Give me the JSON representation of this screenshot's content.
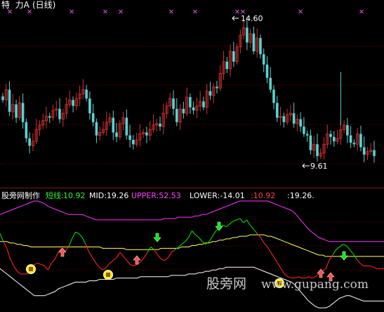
{
  "header": {
    "stock_name": "特  力A",
    "period": "(日线)",
    "peak_label": "14.60",
    "low_label": "9.61"
  },
  "indicator_bar": {
    "source": "股旁网制作",
    "short_label": "短线:",
    "short_value": "10.92",
    "mid_text": "MID:19.26",
    "upper_text": "UPPER:52.53",
    "lower_text": "LOWER:-14.01",
    "extra_value": ":10.92",
    "extra_text": ":19.26."
  },
  "watermark": {
    "cn": "股旁网",
    "url": "www.gupang.com"
  },
  "colors": {
    "up_candle": "#d03030",
    "down_candle": "#5ad2d2",
    "mid_line": "#ffff66",
    "upper_line": "#ff33ff",
    "lower_line": "#ffffff",
    "short_line_green": "#00dd00",
    "short_line_red": "#ff2222",
    "grid": "#8b0000",
    "buy_marker": "#ffee00",
    "up_arrow": "#ff5050",
    "down_arrow": "#00ee00",
    "x_marks": "#cc44cc"
  },
  "chart_data": [
    {
      "type": "candlestick",
      "title": "",
      "ylim": [
        9.2,
        15.2
      ],
      "price_labels": [
        14.6,
        9.61
      ],
      "closes": [
        12.05,
        12.4,
        11.65,
        11.9,
        11.45,
        11.95,
        11.3,
        10.75,
        10.5,
        10.65,
        11.05,
        11.2,
        11.35,
        11.5,
        11.45,
        11.7,
        11.75,
        11.4,
        11.6,
        11.9,
        12.05,
        11.85,
        12.1,
        12.25,
        12.4,
        12.1,
        11.6,
        11.3,
        10.85,
        10.95,
        11.05,
        11.3,
        11.45,
        10.95,
        10.8,
        11.25,
        11.45,
        10.85,
        10.7,
        10.55,
        10.7,
        10.9,
        10.95,
        10.85,
        11.05,
        11.2,
        11.25,
        11.15,
        11.6,
        11.85,
        12.1,
        11.75,
        11.3,
        11.75,
        11.6,
        12.15,
        11.8,
        11.7,
        11.85,
        12.0,
        11.8,
        12.35,
        12.2,
        12.5,
        12.45,
        12.95,
        13.35,
        13.1,
        13.7,
        13.35,
        13.85,
        14.25,
        14.5,
        14.0,
        14.3,
        13.7,
        14.15,
        13.6,
        13.25,
        12.8,
        12.4,
        11.95,
        11.45,
        11.5,
        11.3,
        11.55,
        11.6,
        11.25,
        11.4,
        11.15,
        10.9,
        10.85,
        10.35,
        10.55,
        10.15,
        10.25,
        10.55,
        10.9,
        10.8,
        10.65,
        10.75,
        11.05,
        11.2,
        10.85,
        10.6,
        10.55,
        10.9,
        10.45,
        10.2,
        10.3,
        10.35,
        10.15
      ]
    },
    {
      "type": "line",
      "title": "",
      "ylim": [
        -20,
        60
      ],
      "series": [
        {
          "name": "短线",
          "values": [
            36,
            30,
            25,
            17,
            12,
            8,
            6,
            6,
            6,
            9,
            13,
            14,
            13,
            12,
            9,
            14,
            17,
            22,
            25,
            23,
            26,
            32,
            37,
            36,
            33,
            28,
            22,
            18,
            14,
            11,
            9,
            11,
            14,
            16,
            18,
            22,
            19,
            16,
            13,
            12,
            13,
            15,
            18,
            22,
            26,
            24,
            20,
            17,
            16,
            18,
            22,
            24,
            26,
            28,
            30,
            33,
            38,
            35,
            33,
            30,
            28,
            30,
            34,
            38,
            40,
            42,
            41,
            43,
            45,
            46,
            47,
            44,
            46,
            42,
            39,
            36,
            33,
            29,
            26,
            22,
            18,
            14,
            10,
            6,
            4,
            3,
            3,
            4,
            3,
            3,
            4,
            3,
            4,
            6,
            8,
            10,
            16,
            20,
            24,
            26,
            28,
            27,
            24,
            21,
            17,
            14,
            12,
            12,
            12,
            11,
            10,
            10,
            10
          ]
        },
        {
          "name": "MID",
          "values": [
            30,
            30,
            30,
            29,
            29,
            28,
            28,
            27,
            27,
            26,
            26,
            26,
            26,
            26,
            26,
            26,
            26,
            26,
            26,
            26,
            26,
            26,
            26,
            26,
            26,
            26,
            26,
            26,
            26,
            26,
            25,
            25,
            25,
            25,
            25,
            25,
            25,
            24,
            24,
            24,
            24,
            24,
            24,
            24,
            24,
            24,
            24,
            25,
            25,
            25,
            25,
            25,
            25,
            26,
            26,
            26,
            27,
            27,
            28,
            28,
            29,
            29,
            30,
            30,
            31,
            31,
            32,
            32,
            33,
            33,
            34,
            34,
            34,
            35,
            35,
            35,
            35,
            35,
            34,
            34,
            33,
            32,
            31,
            30,
            29,
            28,
            27,
            26,
            25,
            24,
            23,
            22,
            21,
            20,
            20,
            19,
            19,
            19,
            19,
            19,
            19,
            19,
            19,
            19,
            19,
            19,
            19,
            19,
            19,
            19,
            19,
            19,
            19
          ]
        },
        {
          "name": "UPPER",
          "values": [
            50,
            51,
            52,
            53,
            54,
            55,
            56,
            57,
            58,
            59,
            60,
            60,
            59,
            58,
            56,
            55,
            54,
            53,
            52,
            51,
            50,
            50,
            50,
            50,
            50,
            49,
            48,
            47,
            46,
            46,
            46,
            46,
            46,
            46,
            46,
            46,
            46,
            46,
            46,
            46,
            46,
            46,
            46,
            46,
            46,
            46,
            46,
            46,
            47,
            47,
            47,
            47,
            48,
            48,
            48,
            48,
            48,
            49,
            49,
            50,
            50,
            51,
            52,
            53,
            54,
            55,
            56,
            57,
            58,
            59,
            60,
            60,
            60,
            60,
            60,
            60,
            60,
            60,
            60,
            59,
            58,
            57,
            56,
            55,
            54,
            53,
            51,
            48,
            45,
            42,
            39,
            37,
            35,
            33,
            32,
            31,
            30,
            30,
            30,
            30,
            30,
            30,
            30,
            30,
            30,
            30,
            30,
            30,
            30,
            30,
            30,
            30,
            30
          ]
        },
        {
          "name": "LOWER",
          "values": [
            10,
            8,
            6,
            4,
            2,
            0,
            -2,
            -4,
            -6,
            -8,
            -10,
            -10,
            -10,
            -10,
            -9,
            -8,
            -7,
            -5,
            -4,
            -3,
            -2,
            -1,
            0,
            0,
            0,
            0,
            1,
            1,
            1,
            2,
            2,
            2,
            2,
            2,
            3,
            3,
            3,
            3,
            3,
            3,
            3,
            4,
            4,
            4,
            4,
            4,
            4,
            4,
            4,
            4,
            5,
            5,
            5,
            5,
            5,
            6,
            6,
            6,
            7,
            7,
            8,
            8,
            9,
            9,
            10,
            10,
            11,
            11,
            11,
            11,
            11,
            11,
            11,
            11,
            11,
            10,
            9,
            8,
            7,
            6,
            5,
            4,
            3,
            2,
            1,
            0,
            -2,
            -5,
            -8,
            -11,
            -14,
            -16,
            -18,
            -19,
            -19,
            -19,
            -18,
            -16,
            -14,
            -12,
            -11,
            -10,
            -10,
            -11,
            -12,
            -13,
            -14,
            -14,
            -14,
            -14,
            -14,
            -14,
            -14
          ]
        }
      ]
    }
  ]
}
